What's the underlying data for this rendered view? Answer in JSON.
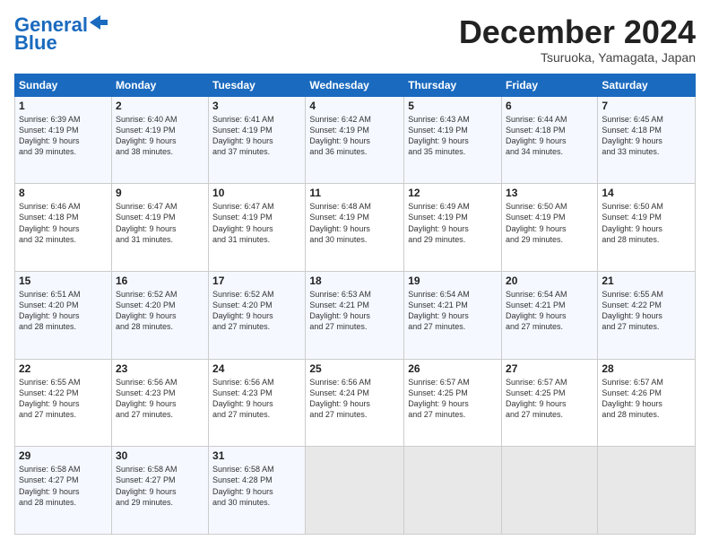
{
  "logo": {
    "line1": "General",
    "line2": "Blue"
  },
  "header": {
    "month": "December 2024",
    "location": "Tsuruoka, Yamagata, Japan"
  },
  "days_of_week": [
    "Sunday",
    "Monday",
    "Tuesday",
    "Wednesday",
    "Thursday",
    "Friday",
    "Saturday"
  ],
  "weeks": [
    [
      {
        "day": "1",
        "info": "Sunrise: 6:39 AM\nSunset: 4:19 PM\nDaylight: 9 hours\nand 39 minutes."
      },
      {
        "day": "2",
        "info": "Sunrise: 6:40 AM\nSunset: 4:19 PM\nDaylight: 9 hours\nand 38 minutes."
      },
      {
        "day": "3",
        "info": "Sunrise: 6:41 AM\nSunset: 4:19 PM\nDaylight: 9 hours\nand 37 minutes."
      },
      {
        "day": "4",
        "info": "Sunrise: 6:42 AM\nSunset: 4:19 PM\nDaylight: 9 hours\nand 36 minutes."
      },
      {
        "day": "5",
        "info": "Sunrise: 6:43 AM\nSunset: 4:19 PM\nDaylight: 9 hours\nand 35 minutes."
      },
      {
        "day": "6",
        "info": "Sunrise: 6:44 AM\nSunset: 4:18 PM\nDaylight: 9 hours\nand 34 minutes."
      },
      {
        "day": "7",
        "info": "Sunrise: 6:45 AM\nSunset: 4:18 PM\nDaylight: 9 hours\nand 33 minutes."
      }
    ],
    [
      {
        "day": "8",
        "info": "Sunrise: 6:46 AM\nSunset: 4:18 PM\nDaylight: 9 hours\nand 32 minutes."
      },
      {
        "day": "9",
        "info": "Sunrise: 6:47 AM\nSunset: 4:19 PM\nDaylight: 9 hours\nand 31 minutes."
      },
      {
        "day": "10",
        "info": "Sunrise: 6:47 AM\nSunset: 4:19 PM\nDaylight: 9 hours\nand 31 minutes."
      },
      {
        "day": "11",
        "info": "Sunrise: 6:48 AM\nSunset: 4:19 PM\nDaylight: 9 hours\nand 30 minutes."
      },
      {
        "day": "12",
        "info": "Sunrise: 6:49 AM\nSunset: 4:19 PM\nDaylight: 9 hours\nand 29 minutes."
      },
      {
        "day": "13",
        "info": "Sunrise: 6:50 AM\nSunset: 4:19 PM\nDaylight: 9 hours\nand 29 minutes."
      },
      {
        "day": "14",
        "info": "Sunrise: 6:50 AM\nSunset: 4:19 PM\nDaylight: 9 hours\nand 28 minutes."
      }
    ],
    [
      {
        "day": "15",
        "info": "Sunrise: 6:51 AM\nSunset: 4:20 PM\nDaylight: 9 hours\nand 28 minutes."
      },
      {
        "day": "16",
        "info": "Sunrise: 6:52 AM\nSunset: 4:20 PM\nDaylight: 9 hours\nand 28 minutes."
      },
      {
        "day": "17",
        "info": "Sunrise: 6:52 AM\nSunset: 4:20 PM\nDaylight: 9 hours\nand 27 minutes."
      },
      {
        "day": "18",
        "info": "Sunrise: 6:53 AM\nSunset: 4:21 PM\nDaylight: 9 hours\nand 27 minutes."
      },
      {
        "day": "19",
        "info": "Sunrise: 6:54 AM\nSunset: 4:21 PM\nDaylight: 9 hours\nand 27 minutes."
      },
      {
        "day": "20",
        "info": "Sunrise: 6:54 AM\nSunset: 4:21 PM\nDaylight: 9 hours\nand 27 minutes."
      },
      {
        "day": "21",
        "info": "Sunrise: 6:55 AM\nSunset: 4:22 PM\nDaylight: 9 hours\nand 27 minutes."
      }
    ],
    [
      {
        "day": "22",
        "info": "Sunrise: 6:55 AM\nSunset: 4:22 PM\nDaylight: 9 hours\nand 27 minutes."
      },
      {
        "day": "23",
        "info": "Sunrise: 6:56 AM\nSunset: 4:23 PM\nDaylight: 9 hours\nand 27 minutes."
      },
      {
        "day": "24",
        "info": "Sunrise: 6:56 AM\nSunset: 4:23 PM\nDaylight: 9 hours\nand 27 minutes."
      },
      {
        "day": "25",
        "info": "Sunrise: 6:56 AM\nSunset: 4:24 PM\nDaylight: 9 hours\nand 27 minutes."
      },
      {
        "day": "26",
        "info": "Sunrise: 6:57 AM\nSunset: 4:25 PM\nDaylight: 9 hours\nand 27 minutes."
      },
      {
        "day": "27",
        "info": "Sunrise: 6:57 AM\nSunset: 4:25 PM\nDaylight: 9 hours\nand 27 minutes."
      },
      {
        "day": "28",
        "info": "Sunrise: 6:57 AM\nSunset: 4:26 PM\nDaylight: 9 hours\nand 28 minutes."
      }
    ],
    [
      {
        "day": "29",
        "info": "Sunrise: 6:58 AM\nSunset: 4:27 PM\nDaylight: 9 hours\nand 28 minutes."
      },
      {
        "day": "30",
        "info": "Sunrise: 6:58 AM\nSunset: 4:27 PM\nDaylight: 9 hours\nand 29 minutes."
      },
      {
        "day": "31",
        "info": "Sunrise: 6:58 AM\nSunset: 4:28 PM\nDaylight: 9 hours\nand 30 minutes."
      },
      {
        "day": "",
        "info": ""
      },
      {
        "day": "",
        "info": ""
      },
      {
        "day": "",
        "info": ""
      },
      {
        "day": "",
        "info": ""
      }
    ]
  ]
}
